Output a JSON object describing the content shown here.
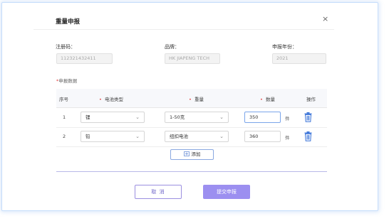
{
  "dialog": {
    "title": "重量申报",
    "close_glyph": "×"
  },
  "fields": {
    "reg_code": {
      "label": "注册码：",
      "value": "11232143241​1"
    },
    "brand": {
      "label": "品牌：",
      "value": "HK JIAPENG TECH"
    },
    "year": {
      "label": "申报年份：",
      "value": "2021"
    }
  },
  "section": {
    "required_mark": "*",
    "title": "申报数据"
  },
  "table": {
    "headers": {
      "index": "序号",
      "battery_type": "电池类型",
      "weight": "重量",
      "quantity": "数量",
      "action": "操作"
    },
    "required_mark": "•",
    "rows": [
      {
        "index": "1",
        "battery_type": "锂",
        "weight": "1-50克",
        "quantity": "350",
        "unit": "件"
      },
      {
        "index": "2",
        "battery_type": "铅",
        "weight": "纽扣电池",
        "quantity": "360",
        "unit": "件"
      }
    ],
    "icons": {
      "chevron": "chevron-down-icon",
      "trash": "trash-icon",
      "add": "add-row-icon"
    }
  },
  "add_button": {
    "label": "添加"
  },
  "footer": {
    "cancel_label": "取 消",
    "submit_label": "提交申报"
  },
  "colors": {
    "accent": "#9c8ff0",
    "required": "#e34040",
    "trash": "#3a73d8"
  }
}
